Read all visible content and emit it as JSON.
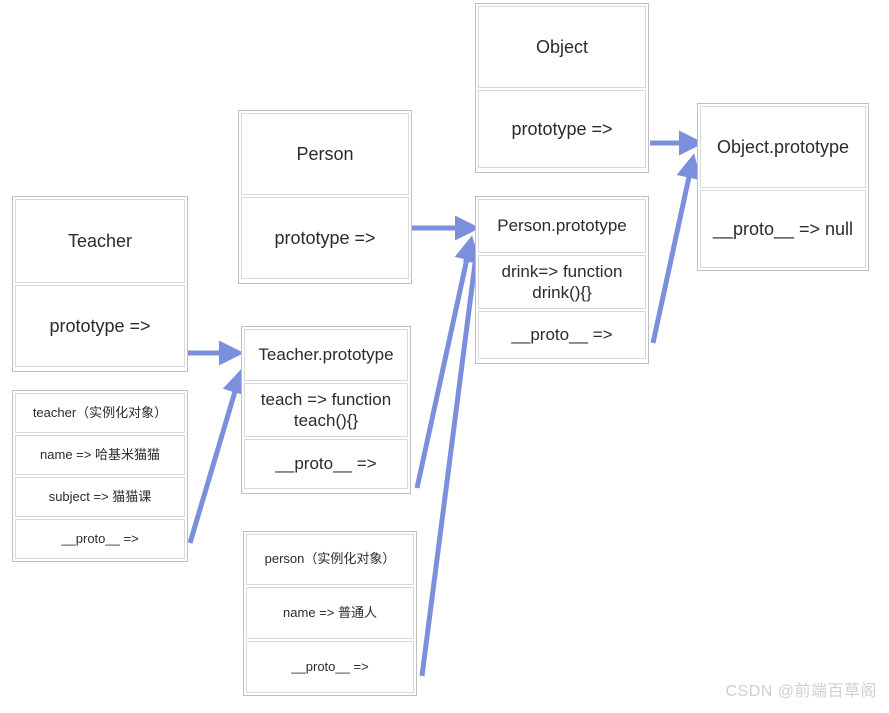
{
  "diagram": {
    "title": "JavaScript prototype chain diagram",
    "arrow_color": "#7b8fdd",
    "border_color": "#bfbfbf",
    "inner_border_color": "#d9d9d9",
    "background": "#ffffff"
  },
  "nodes": {
    "teacher_ctor": {
      "name": "Teacher",
      "prototype_row": "prototype =>"
    },
    "teacher_instance": {
      "title": "teacher（实例化对象）",
      "name_row": "name => 哈基米猫猫",
      "subject_row": "subject => 猫猫课",
      "proto_row": "__proto__ =>"
    },
    "teacher_prototype": {
      "title": "Teacher.prototype",
      "method_row": "teach => function teach(){}",
      "proto_row": "__proto__ =>"
    },
    "person_ctor": {
      "name": "Person",
      "prototype_row": "prototype =>"
    },
    "person_instance": {
      "title": "person（实例化对象）",
      "name_row": "name => 普通人",
      "proto_row": "__proto__ =>"
    },
    "person_prototype": {
      "title": "Person.prototype",
      "method_row": "drink=> function drink(){}",
      "proto_row": "__proto__ =>"
    },
    "object_ctor": {
      "name": "Object",
      "prototype_row": "prototype =>"
    },
    "object_prototype": {
      "title": "Object.prototype",
      "proto_row": "__proto__ => null"
    }
  },
  "watermark": {
    "text": "CSDN @前端百草阁"
  }
}
